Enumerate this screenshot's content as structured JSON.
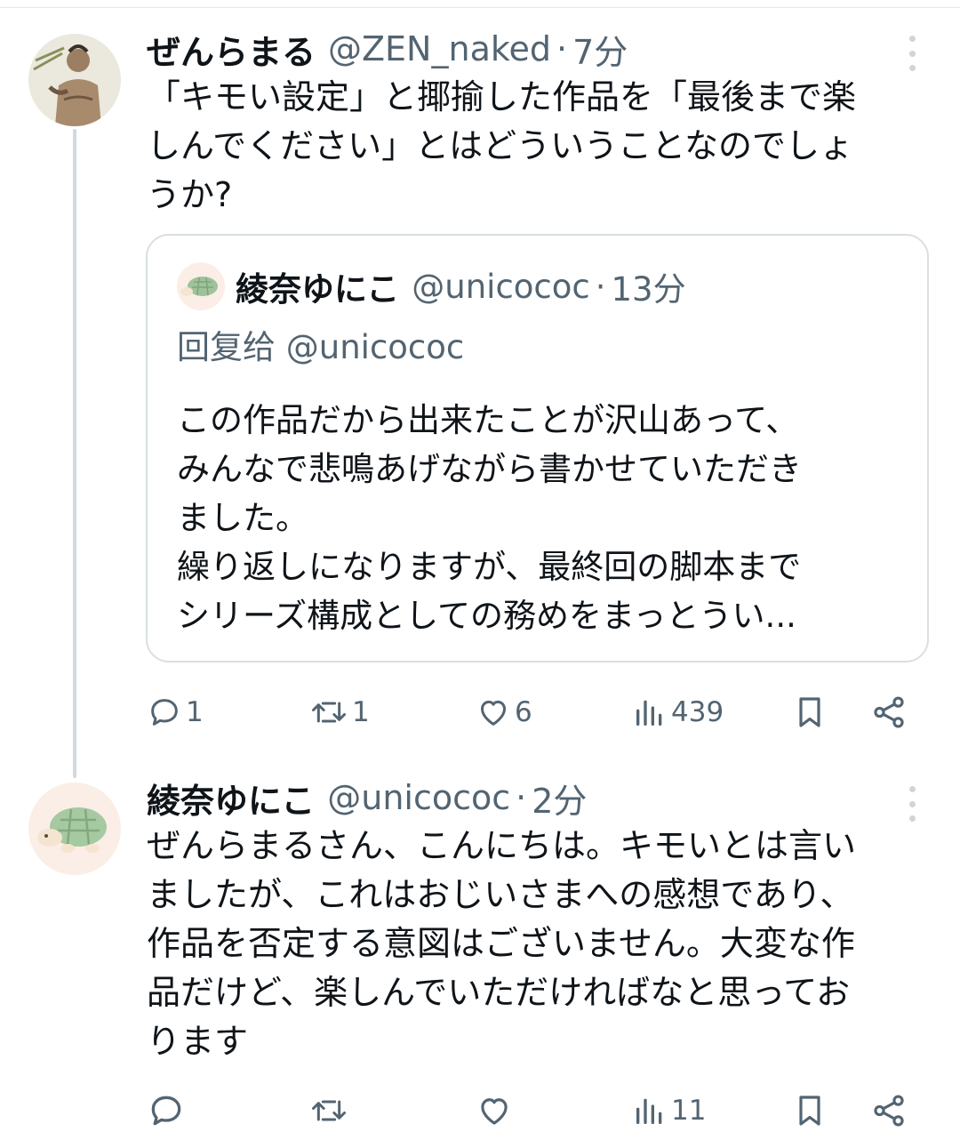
{
  "tweet1": {
    "author_name": "ぜんらまる",
    "author_handle": "@ZEN_naked",
    "separator": "·",
    "time": "7分",
    "text": "「キモい設定」と揶揄した作品を「最後まで楽\nしんでください」とはどういうことなのでしょ\nうか?",
    "quote": {
      "author_name": "綾奈ゆにこ",
      "author_handle": "@unicococ",
      "separator": "·",
      "time": "13分",
      "reply_to": "回复给 @unicococ",
      "text": "この作品だから出来たことが沢山あって、\nみんなで悲鳴あげながら書かせていただき\nました。\n繰り返しになりますが、最終回の脚本まで\nシリーズ構成としての務めをまっとうい..."
    },
    "actions": {
      "replies": "1",
      "retweets": "1",
      "likes": "6",
      "views": "439"
    }
  },
  "tweet2": {
    "author_name": "綾奈ゆにこ",
    "author_handle": "@unicococ",
    "separator": "·",
    "time": "2分",
    "text": "ぜんらまるさん、こんにちは。キモいとは言い\nましたが、これはおじいさまへの感想であり、\n作品を否定する意図はございません。大変な作\n品だけど、楽しんでいただければなと思ってお\nります",
    "actions": {
      "replies": "",
      "retweets": "",
      "likes": "",
      "views": "11"
    }
  },
  "icons": [
    "more-vertical-icon",
    "reply-icon",
    "retweet-icon",
    "like-icon",
    "views-icon",
    "bookmark-icon",
    "share-icon"
  ],
  "colors": {
    "text": "#0f1419",
    "secondary": "#536471",
    "border": "#d9dfe3",
    "thread_line": "#cfd9de"
  }
}
